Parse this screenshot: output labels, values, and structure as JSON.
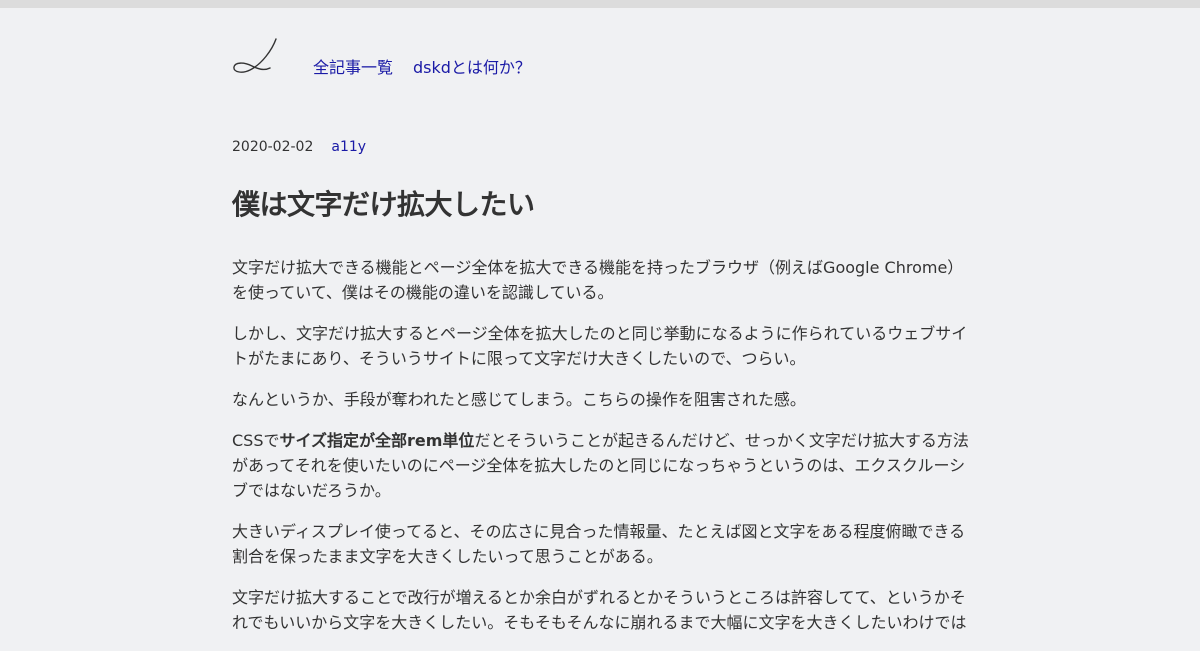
{
  "nav": {
    "all_articles": "全記事一覧",
    "about": "dskdとは何か？"
  },
  "post": {
    "date": "2020-02-02",
    "tag": "a11y",
    "title": "僕は文字だけ拡大したい",
    "paragraphs": {
      "p1": "文字だけ拡大できる機能とページ全体を拡大できる機能を持ったブラウザ（例えばGoogle Chrome）を使っていて、僕はその機能の違いを認識している。",
      "p2": "しかし、文字だけ拡大するとページ全体を拡大したのと同じ挙動になるように作られているウェブサイトがたまにあり、そういうサイトに限って文字だけ大きくしたいので、つらい。",
      "p3": "なんというか、手段が奪われたと感じてしまう。こちらの操作を阻害された感。",
      "p4_before": "CSSで",
      "p4_strong": "サイズ指定が全部rem単位",
      "p4_after": "だとそういうことが起きるんだけど、せっかく文字だけ拡大する方法があってそれを使いたいのにページ全体を拡大したのと同じになっちゃうというのは、エクスクルーシブではないだろうか。",
      "p5": "大きいディスプレイ使ってると、その広さに見合った情報量、たとえば図と文字をある程度俯瞰できる割合を保ったまま文字を大きくしたいって思うことがある。",
      "p6": "文字だけ拡大することで改行が増えるとか余白がずれるとかそういうところは許容してて、というかそれでもいいから文字を大きくしたい。そもそもそんなに崩れるまで大幅に文字を大きくしたいわけでは"
    }
  },
  "colors": {
    "background": "#f0f1f3",
    "topbar": "#dcdcdc",
    "link": "#1a1aa6",
    "text": "#333333"
  },
  "icons": {
    "logo": "signature-logo-icon"
  }
}
